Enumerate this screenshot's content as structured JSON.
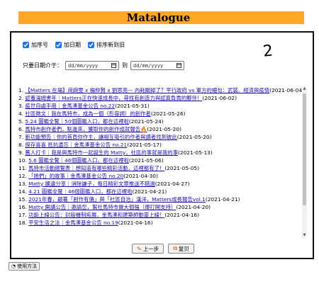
{
  "header": {
    "title": "Matalogue"
  },
  "annotation": {
    "scribble": "2"
  },
  "filters": {
    "show_number": {
      "label": "加序号",
      "checked": true
    },
    "show_date": {
      "label": "加日期",
      "checked": true
    },
    "sort_newest": {
      "label": "排序新到旧",
      "checked": true
    }
  },
  "date_range": {
    "label": "只要日期介于：",
    "from_placeholder": "dd/mm/yyyy",
    "to_label": "到",
    "to_placeholder": "dd/mm/yyyy"
  },
  "items": [
    {
      "num": "1.",
      "title": "【Matters 在場】崗婉雯 x 楊仲賢 x 劉思亮— 內耗關掉了？平行政府 vs 軍方的縮句：武裝、經濟與疫情",
      "date": "(2021-06-04)"
    },
    {
      "num": "2.",
      "title": "認養湯姆書年｜Matters正在快速成長中，尋找有創造力與認真負責的夥伴！",
      "date": "(2021-06-02)"
    },
    {
      "num": "3.",
      "title": "疫世自處手冊｜金馬湊基金公告 no.22",
      "date": "(2021-05-31)"
    },
    {
      "num": "4.",
      "title": "社區徵文｜我在馬特市，成為一個（形容詞）的創作者",
      "date": "(2021-05-26)"
    },
    {
      "num": "5.",
      "title": "5.24 圖鑑全覽｜50個圖鑑入口，都在這裡啦",
      "date": "(2021-05-24)"
    },
    {
      "num": "6.",
      "title": "馬特市創作者們，點進來，獲取你的創作成就報告🔥",
      "date": "(2021-05-20)"
    },
    {
      "num": "7.",
      "title": "新功能預告｜你的首頁你作主，讓相互吸引的作者與讀者找到彼此",
      "date": "(2021-05-20)"
    },
    {
      "num": "8.",
      "title": "探存喜喜 抵抗遺忘｜金馬湊基金公告 no.21",
      "date": "(2021-05-17)"
    },
    {
      "num": "9.",
      "title": "舊人打卡｜我是與馬特市一起誕生的 Matty，社區的事就是我的事",
      "date": "(2021-05-13)"
    },
    {
      "num": "10.",
      "title": "5.6 圖鑑全覽｜46個圖鑑入口，都在這裡啦",
      "date": "(2021-05-06)"
    },
    {
      "num": "11.",
      "title": "馬特市活動總覽表｜想知道有哪些精彩活動，這裡都有了！",
      "date": "(2021-05-05)"
    },
    {
      "num": "12.",
      "title": "「她們」的故事｜金馬湊基金公告 no.20",
      "date": "(2021-04-30)"
    },
    {
      "num": "13.",
      "title": "Matty 擴邊分享｜消除謙子，每日精彩文章推送不錯過",
      "date": "(2021-04-27)"
    },
    {
      "num": "14.",
      "title": "4.21 圖鑑全覽｜46個圖鑑入口，都在這裡啦",
      "date": "(2021-04-21)"
    },
    {
      "num": "15.",
      "title": "2021年春，顧著「創作有價」與「社區自治」漢洋，Matters成長報告vol.1",
      "date": "(2021-04-21)"
    },
    {
      "num": "16.",
      "title": "Matty 開講公告｜邀請您，幫社馬特市做大個強（爆打開支持）",
      "date": "(2021-04-20)"
    },
    {
      "num": "17.",
      "title": "功能上線公告：封殺機制拓展，金馬湊和建築師動靈上線！",
      "date": "(2021-04-16)"
    },
    {
      "num": "18.",
      "title": "平安生活之法｜金馬湊基金公告 no.19",
      "date": "(2021-04-16)"
    }
  ],
  "pager": {
    "prev_label": "上一步",
    "copy_label": "复贝"
  },
  "footer": {
    "usage_label": "使用方法"
  }
}
